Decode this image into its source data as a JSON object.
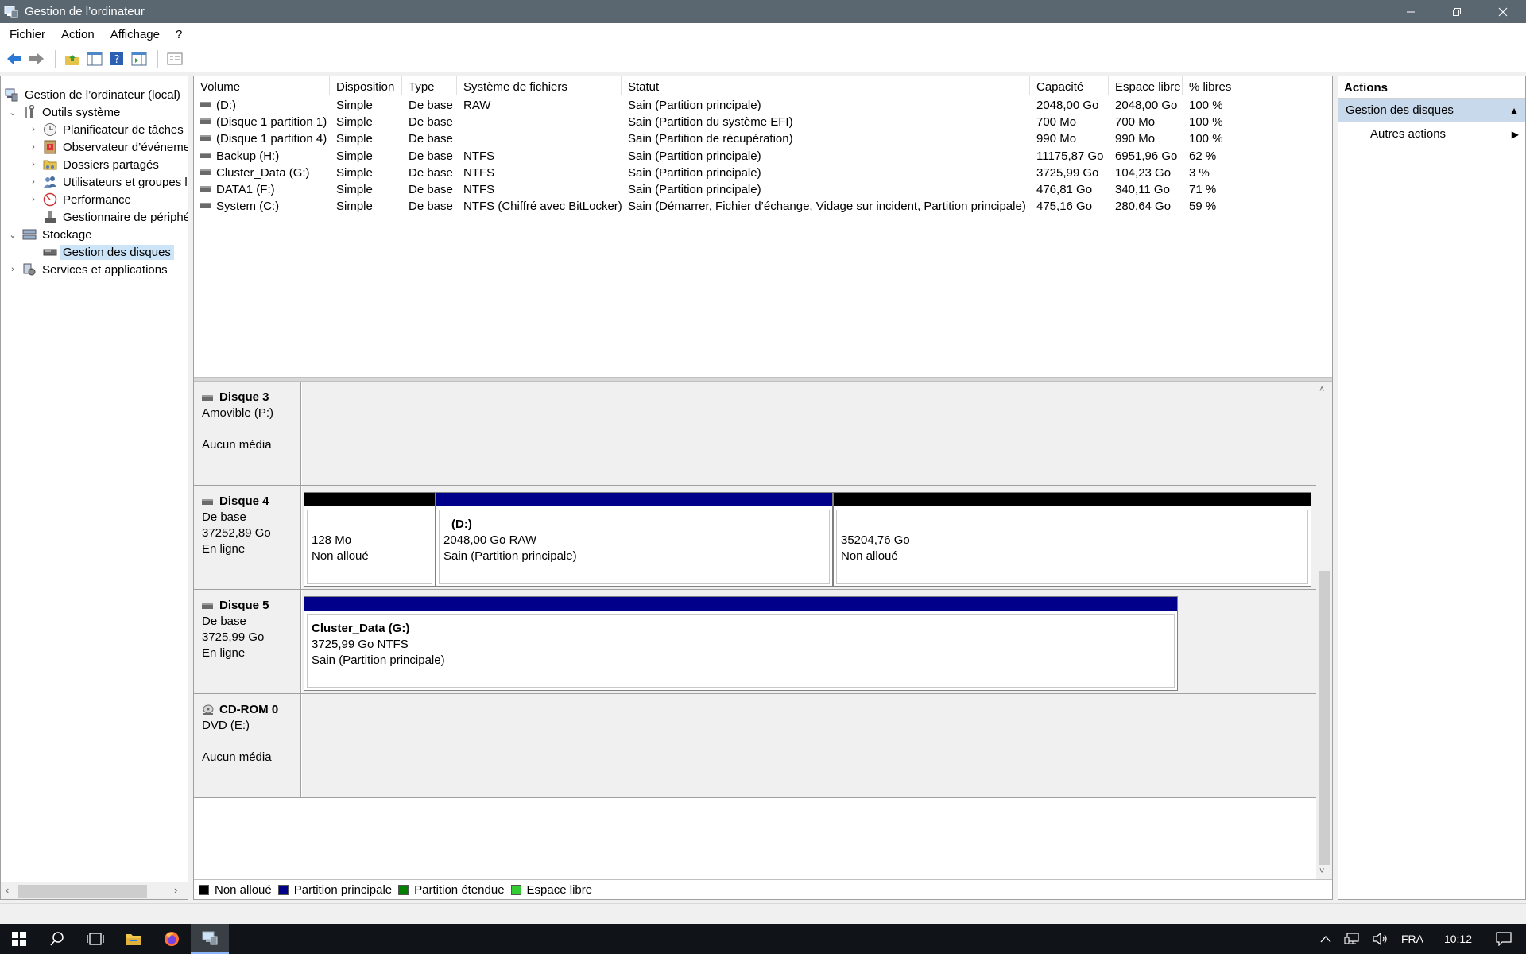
{
  "window": {
    "title": "Gestion de l’ordinateur"
  },
  "menu": [
    "Fichier",
    "Action",
    "Affichage",
    "?"
  ],
  "tree": {
    "root": "Gestion de l’ordinateur (local)",
    "system_tools": "Outils système",
    "task_scheduler": "Planificateur de tâches",
    "event_viewer": "Observateur d’événeme",
    "shared_folders": "Dossiers partagés",
    "users_groups": "Utilisateurs et groupes l",
    "performance": "Performance",
    "device_manager": "Gestionnaire de périphé",
    "storage": "Stockage",
    "disk_management": "Gestion des disques",
    "services_apps": "Services et applications"
  },
  "volumes": {
    "headers": [
      "Volume",
      "Disposition",
      "Type",
      "Système de fichiers",
      "Statut",
      "Capacité",
      "Espace libre",
      "% libres"
    ],
    "rows": [
      [
        "(D:)",
        "Simple",
        "De base",
        "RAW",
        "Sain (Partition principale)",
        "2048,00 Go",
        "2048,00 Go",
        "100 %"
      ],
      [
        "(Disque 1 partition 1)",
        "Simple",
        "De base",
        "",
        "Sain (Partition du système EFI)",
        "700 Mo",
        "700 Mo",
        "100 %"
      ],
      [
        "(Disque 1 partition 4)",
        "Simple",
        "De base",
        "",
        "Sain (Partition de récupération)",
        "990 Mo",
        "990 Mo",
        "100 %"
      ],
      [
        "Backup (H:)",
        "Simple",
        "De base",
        "NTFS",
        "Sain (Partition principale)",
        "11175,87 Go",
        "6951,96 Go",
        "62 %"
      ],
      [
        "Cluster_Data (G:)",
        "Simple",
        "De base",
        "NTFS",
        "Sain (Partition principale)",
        "3725,99 Go",
        "104,23 Go",
        "3 %"
      ],
      [
        "DATA1 (F:)",
        "Simple",
        "De base",
        "NTFS",
        "Sain (Partition principale)",
        "476,81 Go",
        "340,11 Go",
        "71 %"
      ],
      [
        "System (C:)",
        "Simple",
        "De base",
        "NTFS (Chiffré avec BitLocker)",
        "Sain (Démarrer, Fichier d’échange, Vidage sur incident, Partition principale)",
        "475,16 Go",
        "280,64 Go",
        "59 %"
      ]
    ]
  },
  "disks": {
    "d3": {
      "name": "Disque 3",
      "line1": "Amovible (P:)",
      "line2": "",
      "line3": "Aucun média"
    },
    "d4": {
      "name": "Disque 4",
      "line1": "De base",
      "line2": "37252,89 Go",
      "line3": "En ligne",
      "p1": {
        "size": "128 Mo",
        "status": "Non alloué"
      },
      "p2": {
        "name": "(D:)",
        "size": "2048,00 Go RAW",
        "status": "Sain (Partition principale)"
      },
      "p3": {
        "size": "35204,76 Go",
        "status": "Non alloué"
      }
    },
    "d5": {
      "name": "Disque 5",
      "line1": "De base",
      "line2": "3725,99 Go",
      "line3": "En ligne",
      "p1": {
        "name": "Cluster_Data  (G:)",
        "size": "3725,99 Go NTFS",
        "status": "Sain (Partition principale)"
      }
    },
    "cd": {
      "name": "CD-ROM 0",
      "line1": "DVD (E:)",
      "line2": "",
      "line3": "Aucun média"
    }
  },
  "legend": {
    "unallocated": "Non alloué",
    "primary": "Partition principale",
    "extended": "Partition étendue",
    "free": "Espace libre"
  },
  "colors": {
    "unallocated": "#000000",
    "primary": "#00008b",
    "extended": "#008000",
    "free": "#32cd32"
  },
  "actions": {
    "header": "Actions",
    "section": "Gestion des disques",
    "more": "Autres actions"
  },
  "taskbar": {
    "lang": "FRA",
    "time": "10:12"
  }
}
